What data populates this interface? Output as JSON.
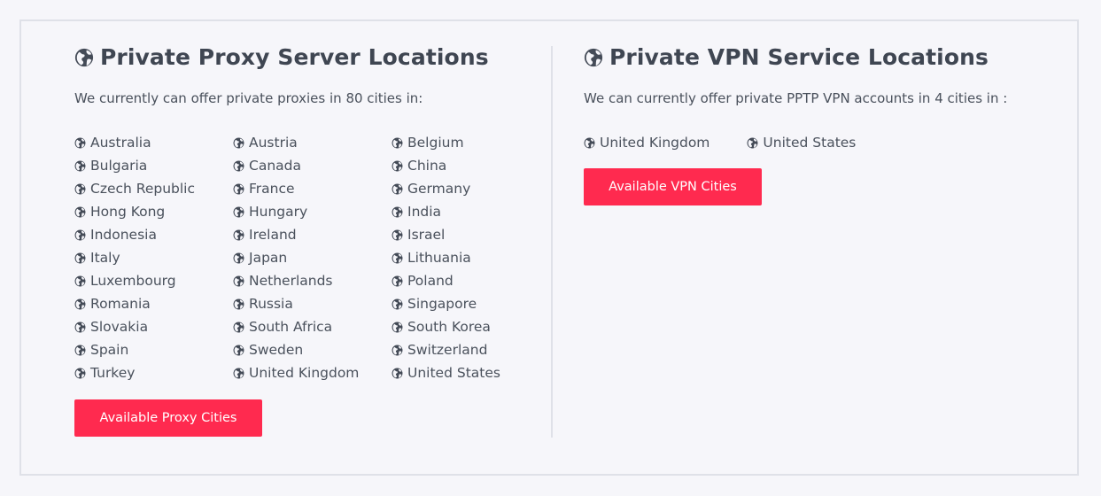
{
  "proxy": {
    "title": "Private Proxy Server Locations",
    "intro": "We currently can offer private proxies in 80 cities in:",
    "locations": [
      "Australia",
      "Austria",
      "Belgium",
      "Bulgaria",
      "Canada",
      "China",
      "Czech Republic",
      "France",
      "Germany",
      "Hong Kong",
      "Hungary",
      "India",
      "Indonesia",
      "Ireland",
      "Israel",
      "Italy",
      "Japan",
      "Lithuania",
      "Luxembourg",
      "Netherlands",
      "Poland",
      "Romania",
      "Russia",
      "Singapore",
      "Slovakia",
      "South Africa",
      "South Korea",
      "Spain",
      "Sweden",
      "Switzerland",
      "Turkey",
      "United Kingdom",
      "United States"
    ],
    "button_label": "Available Proxy Cities",
    "icon": "globe-icon"
  },
  "vpn": {
    "title": "Private VPN Service Locations",
    "intro": "We can currently offer private PPTP VPN accounts in 4 cities in :",
    "locations": [
      "United Kingdom",
      "United States"
    ],
    "button_label": "Available VPN Cities",
    "icon": "globe-icon"
  },
  "colors": {
    "accent": "#ff2a4f",
    "text": "#4a515c",
    "background": "#f6f6fa",
    "border": "#dfe1e8"
  }
}
